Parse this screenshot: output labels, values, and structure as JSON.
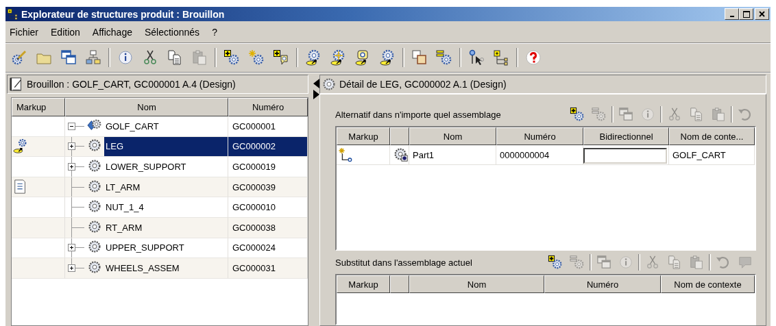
{
  "window": {
    "title": "Explorateur de structures produit : Brouillon"
  },
  "menu": [
    "Fichier",
    "Edition",
    "Affichage",
    "Sélectionnés",
    "?"
  ],
  "toolbar": [
    {
      "kind": "gear-pencil",
      "disabled": false
    },
    {
      "kind": "folder",
      "disabled": false
    },
    {
      "kind": "windows",
      "disabled": false
    },
    {
      "kind": "hierarchy",
      "disabled": false
    },
    {
      "kind": "separator"
    },
    {
      "kind": "info",
      "disabled": false
    },
    {
      "kind": "cut",
      "disabled": false
    },
    {
      "kind": "copy",
      "disabled": false
    },
    {
      "kind": "paste",
      "disabled": true
    },
    {
      "kind": "separator"
    },
    {
      "kind": "gear-add",
      "disabled": false
    },
    {
      "kind": "gear-star",
      "disabled": false
    },
    {
      "kind": "gear-balloon",
      "disabled": false
    },
    {
      "kind": "separator"
    },
    {
      "kind": "gears-link",
      "disabled": false
    },
    {
      "kind": "gears-star-link",
      "disabled": false
    },
    {
      "kind": "gears-balloon-link",
      "disabled": false
    },
    {
      "kind": "gears-link",
      "disabled": false
    },
    {
      "kind": "separator"
    },
    {
      "kind": "ab-box",
      "disabled": false
    },
    {
      "kind": "gear-list",
      "disabled": false
    },
    {
      "kind": "separator"
    },
    {
      "kind": "pin-cursor",
      "disabled": false
    },
    {
      "kind": "tree-add",
      "disabled": false
    },
    {
      "kind": "separator"
    },
    {
      "kind": "help",
      "disabled": false
    }
  ],
  "left_panel": {
    "header": "Brouillon : GOLF_CART, GC000001 A.4 (Design)",
    "columns": [
      "Markup",
      "Nom",
      "Numéro"
    ],
    "tree": [
      {
        "name": "GOLF_CART",
        "number": "GC000001",
        "kind": "assembly",
        "expanded": true,
        "selected": false,
        "children": [
          {
            "name": "LEG",
            "number": "GC000002",
            "kind": "part",
            "expanded": false,
            "selected": true,
            "markup": {
              "kind": "link"
            }
          },
          {
            "name": "LOWER_SUPPORT",
            "number": "GC000019",
            "kind": "part",
            "expanded": false,
            "selected": false
          },
          {
            "name": "LT_ARM",
            "number": "GC000039",
            "kind": "part",
            "selected": false,
            "markup": {
              "kind": "note"
            }
          },
          {
            "name": "NUT_1_4",
            "number": "GC000010",
            "kind": "part",
            "selected": false
          },
          {
            "name": "RT_ARM",
            "number": "GC000038",
            "kind": "part",
            "selected": false
          },
          {
            "name": "UPPER_SUPPORT",
            "number": "GC000024",
            "kind": "part",
            "expanded": false,
            "selected": false
          },
          {
            "name": "WHEELS_ASSEM",
            "number": "GC000031",
            "kind": "part",
            "expanded": false,
            "selected": false
          }
        ]
      }
    ]
  },
  "right_panel": {
    "header": "Détail de LEG, GC000002 A.1 (Design)",
    "sections": [
      {
        "title": "Alternatif dans n'importe quel assemblage",
        "toolbar": [
          {
            "kind": "gear-add",
            "disabled": false
          },
          {
            "kind": "gear-list",
            "disabled": true
          },
          {
            "kind": "separator"
          },
          {
            "kind": "windows",
            "disabled": true
          },
          {
            "kind": "info",
            "disabled": true
          },
          {
            "kind": "separator"
          },
          {
            "kind": "cut",
            "disabled": true
          },
          {
            "kind": "copy",
            "disabled": true
          },
          {
            "kind": "paste",
            "disabled": true
          },
          {
            "kind": "separator"
          },
          {
            "kind": "undo",
            "disabled": true
          }
        ],
        "columns": [
          {
            "kind": "text",
            "label": "Markup"
          },
          {
            "kind": "icon"
          },
          {
            "kind": "text",
            "label": "Nom"
          },
          {
            "kind": "text",
            "label": "Numéro"
          },
          {
            "kind": "text",
            "label": "Bidirectionnel"
          },
          {
            "kind": "text",
            "label": "Nom de conte..."
          }
        ],
        "rows": [
          {
            "cells": [
              {
                "kind": "markup-link"
              },
              {
                "kind": "part-linked"
              },
              {
                "kind": "text",
                "text": "Part1"
              },
              {
                "kind": "text",
                "text": "0000000004"
              },
              {
                "kind": "field"
              },
              {
                "kind": "text",
                "text": "GOLF_CART"
              }
            ]
          }
        ]
      },
      {
        "title": "Substitut dans l'assemblage actuel",
        "toolbar": [
          {
            "kind": "gear-add",
            "disabled": false
          },
          {
            "kind": "gear-list",
            "disabled": true
          },
          {
            "kind": "separator"
          },
          {
            "kind": "windows",
            "disabled": true
          },
          {
            "kind": "info",
            "disabled": true
          },
          {
            "kind": "separator"
          },
          {
            "kind": "cut",
            "disabled": true
          },
          {
            "kind": "copy",
            "disabled": true
          },
          {
            "kind": "paste",
            "disabled": true
          },
          {
            "kind": "separator"
          },
          {
            "kind": "undo",
            "disabled": true
          },
          {
            "kind": "balloon",
            "disabled": true
          }
        ],
        "columns": [
          {
            "kind": "text",
            "label": "Markup"
          },
          {
            "kind": "icon"
          },
          {
            "kind": "text",
            "label": "Nom"
          },
          {
            "kind": "text",
            "label": "Numéro"
          },
          {
            "kind": "text",
            "label": "Nom de contexte"
          }
        ]
      }
    ]
  }
}
